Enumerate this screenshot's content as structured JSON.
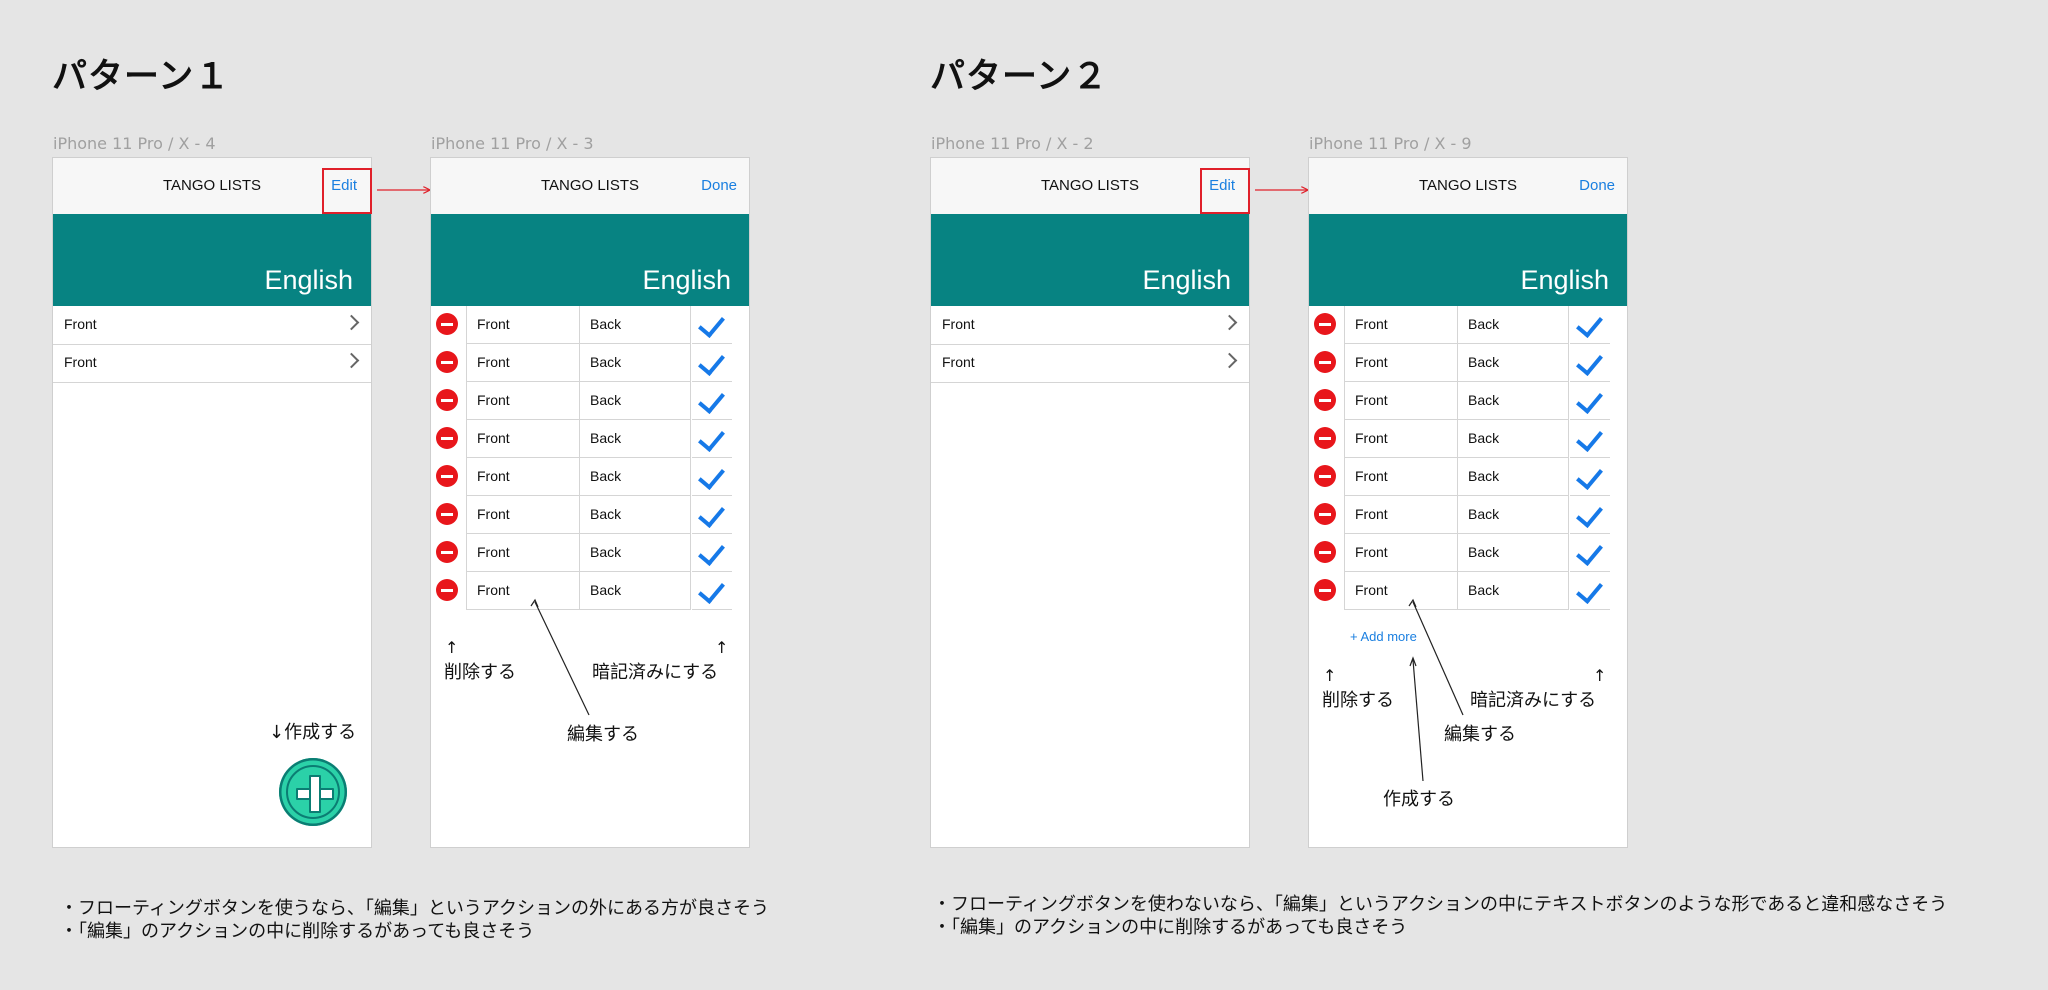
{
  "patterns": [
    {
      "heading": "パターン１",
      "screens": [
        {
          "label": "iPhone 11 Pro / X - 4",
          "nav_title": "TANGO LISTS",
          "nav_button": "Edit",
          "banner": "English",
          "rows": [
            "Front",
            "Front"
          ]
        },
        {
          "label": "iPhone 11 Pro / X - 3",
          "nav_title": "TANGO LISTS",
          "nav_button": "Done",
          "banner": "English",
          "edit_rows": [
            {
              "front": "Front",
              "back": "Back"
            },
            {
              "front": "Front",
              "back": "Back"
            },
            {
              "front": "Front",
              "back": "Back"
            },
            {
              "front": "Front",
              "back": "Back"
            },
            {
              "front": "Front",
              "back": "Back"
            },
            {
              "front": "Front",
              "back": "Back"
            },
            {
              "front": "Front",
              "back": "Back"
            },
            {
              "front": "Front",
              "back": "Back"
            }
          ]
        }
      ],
      "annotations": {
        "create": "↓作成する",
        "delete": "削除する",
        "memorized": "暗記済みにする",
        "edit": "編集する",
        "up_arrow": "↑"
      },
      "notes": [
        "・フローティングボタンを使うなら、「編集」というアクションの外にある方が良さそう",
        "・「編集」のアクションの中に削除するがあっても良さそう"
      ]
    },
    {
      "heading": "パターン２",
      "screens": [
        {
          "label": "iPhone 11 Pro / X - 2",
          "nav_title": "TANGO LISTS",
          "nav_button": "Edit",
          "banner": "English",
          "rows": [
            "Front",
            "Front"
          ]
        },
        {
          "label": "iPhone 11 Pro / X - 9",
          "nav_title": "TANGO LISTS",
          "nav_button": "Done",
          "banner": "English",
          "add_more": "+ Add more",
          "edit_rows": [
            {
              "front": "Front",
              "back": "Back"
            },
            {
              "front": "Front",
              "back": "Back"
            },
            {
              "front": "Front",
              "back": "Back"
            },
            {
              "front": "Front",
              "back": "Back"
            },
            {
              "front": "Front",
              "back": "Back"
            },
            {
              "front": "Front",
              "back": "Back"
            },
            {
              "front": "Front",
              "back": "Back"
            },
            {
              "front": "Front",
              "back": "Back"
            }
          ]
        }
      ],
      "annotations": {
        "create": "作成する",
        "delete": "削除する",
        "memorized": "暗記済みにする",
        "edit": "編集する",
        "up_arrow": "↑"
      },
      "notes": [
        "・フローティングボタンを使わないなら、「編集」というアクションの中にテキストボタンのような形であると違和感なさそう",
        "・「編集」のアクションの中に削除するがあっても良さそう"
      ]
    }
  ],
  "colors": {
    "background": "#e5e5e5",
    "banner": "#078382",
    "link_blue": "#1a7fe0",
    "delete_red": "#e8161b",
    "highlight_red": "#e0202a",
    "fab_green": "#2bd1a8"
  },
  "icons": [
    "chevron-right-icon",
    "delete-minus-icon",
    "checkmark-icon",
    "plus-fab-icon"
  ]
}
